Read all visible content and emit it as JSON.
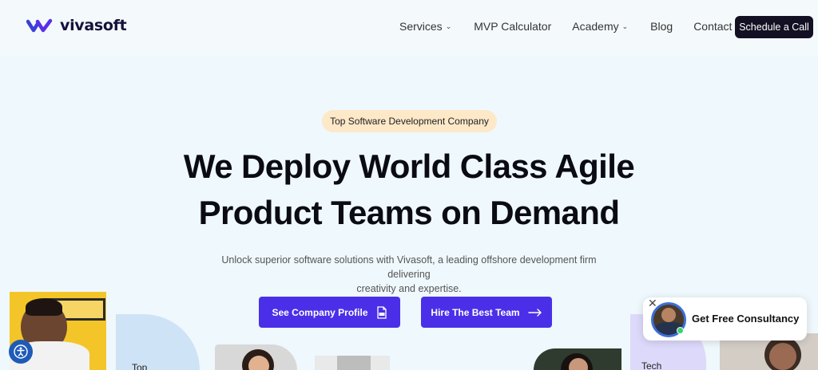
{
  "brand": {
    "name": "vivasoft",
    "accent": "#4b2fe8",
    "dark": "#121022"
  },
  "nav": {
    "items": [
      {
        "label": "Services",
        "dropdown": true
      },
      {
        "label": "MVP Calculator",
        "dropdown": false
      },
      {
        "label": "Academy",
        "dropdown": true
      },
      {
        "label": "Blog",
        "dropdown": false
      },
      {
        "label": "Contact",
        "dropdown": false
      }
    ],
    "cta_label": "Schedule a Call"
  },
  "hero": {
    "badge": "Top Software Development Company",
    "headline_line1": "We Deploy World Class Agile",
    "headline_line2": "Product Teams on Demand",
    "subtext_line1": "Unlock superior software solutions with Vivasoft, a leading offshore development firm delivering",
    "subtext_line2": "creativity and expertise.",
    "btn_profile": "See Company Profile",
    "btn_hire": "Hire The Best Team"
  },
  "tiles": {
    "label_left": "Top",
    "label_right": "Tech"
  },
  "consult": {
    "label": "Get Free Consultancy"
  },
  "icons": {
    "pdf": "pdf-icon",
    "arrow": "arrow-right-icon",
    "close": "close-icon",
    "a11y": "accessibility-icon"
  }
}
